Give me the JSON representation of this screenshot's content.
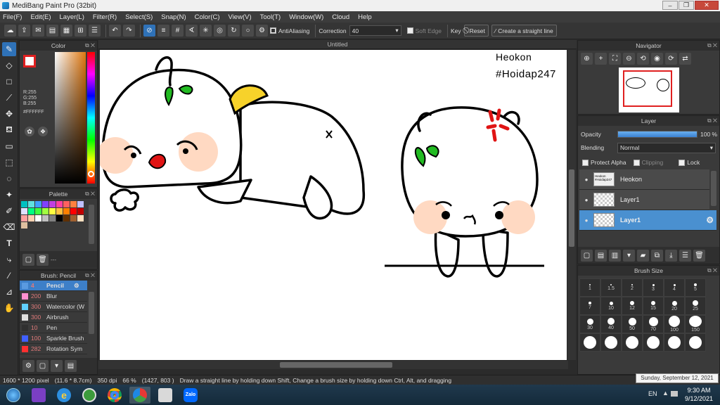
{
  "window": {
    "title": "MediBang Paint Pro (32bit)"
  },
  "menu": [
    "File(F)",
    "Edit(E)",
    "Layer(L)",
    "Filter(R)",
    "Select(S)",
    "Snap(N)",
    "Color(C)",
    "View(V)",
    "Tool(T)",
    "Window(W)",
    "Cloud",
    "Help"
  ],
  "toolbar": {
    "antialiasing_label": "AntiAliasing",
    "correction_label": "Correction",
    "correction_value": "40",
    "soft_edge_label": "Soft Edge",
    "key_label": "Key",
    "reset_label": "Reset",
    "straight_line_label": "Create a straight line"
  },
  "color_panel": {
    "title": "Color",
    "r": "R:255",
    "g": "G:255",
    "b": "B:255",
    "hex": "#FFFFFF"
  },
  "palette_panel": {
    "title": "Palette",
    "footer": "---",
    "swatches": [
      "#00c0c0",
      "#60e0e0",
      "#40a0ff",
      "#8040ff",
      "#c040e0",
      "#ff40a0",
      "#ff6060",
      "#ff8040",
      "#c0c0ff",
      "#e0e0ff",
      "#00ff80",
      "#40ff40",
      "#a0ff40",
      "#ffff40",
      "#ffc040",
      "#ff8000",
      "#ff0000",
      "#c00000",
      "#ffa0a0",
      "#ffd0b0",
      "#ffffff",
      "#c0c0c0",
      "#808080",
      "#000000",
      "#603000",
      "#a06030",
      "#ffe0c0",
      "#e0c0a0"
    ]
  },
  "brush_panel": {
    "title": "Brush: Pencil",
    "items": [
      {
        "size": "4",
        "name": "Pencil",
        "color": "#5a9ae0"
      },
      {
        "size": "200",
        "name": "Blur",
        "color": "#ff90d0"
      },
      {
        "size": "300",
        "name": "Watercolor (W",
        "color": "#60d0ff"
      },
      {
        "size": "300",
        "name": "Airbrush",
        "color": "#e0e0e0"
      },
      {
        "size": "10",
        "name": "Pen",
        "color": "#303030"
      },
      {
        "size": "100",
        "name": "Sparkle Brush",
        "color": "#4060ff"
      },
      {
        "size": "282",
        "name": "Rotation Sym",
        "color": "#ff3030"
      }
    ]
  },
  "canvas": {
    "tab": "Untitled",
    "watermark_line1": "Heokon",
    "watermark_line2": "#Hoidap247"
  },
  "navigator": {
    "title": "Navigator"
  },
  "layer_panel": {
    "title": "Layer",
    "opacity_label": "Opacity",
    "opacity_value": "100 %",
    "opacity_fraction": 1.0,
    "blending_label": "Blending",
    "blending_value": "Normal",
    "protect_alpha": "Protect Alpha",
    "clipping": "Clipping",
    "lock": "Lock",
    "layers": [
      "Heokon",
      "Layer1",
      "Layer1"
    ],
    "heokon_thumb_line1": "Heokon",
    "heokon_thumb_line2": "#Hoidap247"
  },
  "brush_size": {
    "title": "Brush Size",
    "sizes": [
      "1",
      "1.5",
      "2",
      "3",
      "4",
      "5",
      "7",
      "10",
      "12",
      "15",
      "20",
      "25",
      "30",
      "40",
      "50",
      "70",
      "100",
      "150",
      "",
      "",
      "",
      "",
      "",
      ""
    ]
  },
  "status": {
    "dimensions": "1600 * 1200 pixel",
    "physical": "(11.6 * 8.7cm)",
    "dpi": "350 dpi",
    "zoom": "66 %",
    "cursor": "(1427, 803 )",
    "hint": "Draw a straight line by holding down Shift, Change a brush size by holding down Ctrl, Alt, and dragging"
  },
  "taskbar": {
    "lang": "EN",
    "time": "9:30 AM",
    "date": "9/12/2021",
    "tooltip": "Sunday, September 12, 2021",
    "zalo": "Zalo"
  },
  "colors": {
    "accent": "#2f72b8",
    "selected_layer": "#4a90d0",
    "panel": "#3a3a3a"
  }
}
